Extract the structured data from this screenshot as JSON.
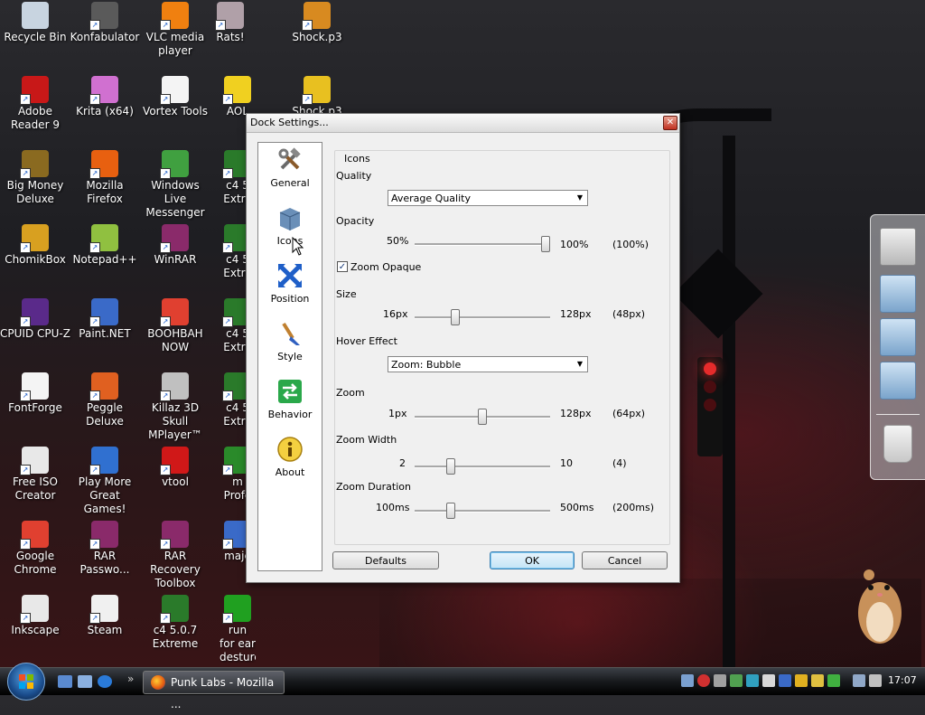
{
  "desktop": {
    "icons": [
      {
        "label": "Recycle Bin",
        "icon": "recycle-bin-icon",
        "color": "#c8d4e0"
      },
      {
        "label": "Konfabulator",
        "icon": "konfabulator-icon",
        "color": "#5a5a5a"
      },
      {
        "label": "VLC media player",
        "icon": "vlc-icon",
        "color": "#f08010"
      },
      {
        "label": "Rats!",
        "icon": "rats-icon",
        "color": "#b0a0a8"
      },
      {
        "label": "Shock.p3",
        "icon": "shock-icon",
        "color": "#d88a20"
      },
      {
        "label": "Adobe Reader 9",
        "icon": "adobe-reader-icon",
        "color": "#c81818"
      },
      {
        "label": "Krita (x64)",
        "icon": "krita-icon",
        "color": "#d070d0"
      },
      {
        "label": "Vortex Tools",
        "icon": "vortex-tools-icon",
        "color": "#f4f4f4"
      },
      {
        "label": "AOL",
        "icon": "aol-icon",
        "color": "#f0d020"
      },
      {
        "label": "Shock.p3",
        "icon": "shock-radiation-icon",
        "color": "#e8c020"
      },
      {
        "label": "Big Money Deluxe",
        "icon": "big-money-icon",
        "color": "#8a6a20"
      },
      {
        "label": "Mozilla Firefox",
        "icon": "firefox-icon",
        "color": "#e86010"
      },
      {
        "label": "Windows Live Messenger",
        "icon": "messenger-icon",
        "color": "#40a040"
      },
      {
        "label": "c4 5 Extre",
        "icon": "c4-icon",
        "color": "#2a7a2a"
      },
      {
        "label": "ChomikBox",
        "icon": "chomikbox-icon",
        "color": "#d8a020"
      },
      {
        "label": "Notepad++",
        "icon": "notepadpp-icon",
        "color": "#90c040"
      },
      {
        "label": "WinRAR",
        "icon": "winrar-icon",
        "color": "#8a2a6a"
      },
      {
        "label": "c4 5 Extre",
        "icon": "c4-icon",
        "color": "#2a7a2a"
      },
      {
        "label": "CPUID CPU-Z",
        "icon": "cpuz-icon",
        "color": "#5a2a8a"
      },
      {
        "label": "Paint.NET",
        "icon": "paintnet-icon",
        "color": "#3a6ac8"
      },
      {
        "label": "BOOHBAH NOW",
        "icon": "chrome-icon",
        "color": "#e04030"
      },
      {
        "label": "c4 5 Extre",
        "icon": "c4-icon",
        "color": "#2a7a2a"
      },
      {
        "label": "FontForge",
        "icon": "fontforge-icon",
        "color": "#f4f4f4"
      },
      {
        "label": "Peggle Deluxe",
        "icon": "peggle-icon",
        "color": "#e06020"
      },
      {
        "label": "Killaz 3D Skull MPlayer™",
        "icon": "mplayer-icon",
        "color": "#c0c0c0"
      },
      {
        "label": "c4 5 Extre",
        "icon": "c4-icon",
        "color": "#2a7a2a"
      },
      {
        "label": "Free ISO Creator",
        "icon": "iso-creator-icon",
        "color": "#e8e8e8"
      },
      {
        "label": "Play More Great Games!",
        "icon": "games-icon",
        "color": "#3070d0"
      },
      {
        "label": "vtool",
        "icon": "vtool-icon",
        "color": "#d01818"
      },
      {
        "label": "m Profe",
        "icon": "profe-icon",
        "color": "#2a8a2a"
      },
      {
        "label": "Google Chrome",
        "icon": "chrome-icon",
        "color": "#e04030"
      },
      {
        "label": "RAR Passwo...",
        "icon": "rar-password-icon",
        "color": "#8a2a6a"
      },
      {
        "label": "RAR Recovery Toolbox",
        "icon": "rar-recovery-icon",
        "color": "#8a2a6a"
      },
      {
        "label": "maje",
        "icon": "maje-icon",
        "color": "#3a6ac8"
      },
      {
        "label": "Inkscape",
        "icon": "inkscape-icon",
        "color": "#e8e8e8"
      },
      {
        "label": "Steam",
        "icon": "steam-icon",
        "color": "#f0f0f0"
      },
      {
        "label": "c4 5.0.7 Extreme",
        "icon": "c4-icon",
        "color": "#2a7a2a"
      },
      {
        "label": "run for ear desturction",
        "icon": "run-icon",
        "color": "#20a020"
      }
    ]
  },
  "dialog": {
    "title": "Dock Settings...",
    "sidebar": [
      {
        "label": "General",
        "icon": "tools-icon"
      },
      {
        "label": "Icons",
        "icon": "box-icon",
        "selected": true
      },
      {
        "label": "Position",
        "icon": "arrows-icon"
      },
      {
        "label": "Style",
        "icon": "brush-icon"
      },
      {
        "label": "Behavior",
        "icon": "behavior-icon"
      },
      {
        "label": "About",
        "icon": "info-icon"
      }
    ],
    "section_title": "Icons",
    "quality": {
      "label": "Quality",
      "value": "Average Quality"
    },
    "opacity": {
      "label": "Opacity",
      "min": "50%",
      "max": "100%",
      "current": "(100%)",
      "level": 1.0
    },
    "zoom_opaque": {
      "label": "Zoom Opaque",
      "checked": true
    },
    "size": {
      "label": "Size",
      "min": "16px",
      "max": "128px",
      "current": "(48px)",
      "level": 0.286
    },
    "hover_effect": {
      "label": "Hover Effect",
      "value": "Zoom: Bubble"
    },
    "zoom": {
      "label": "Zoom",
      "min": "1px",
      "max": "128px",
      "current": "(64px)",
      "level": 0.5
    },
    "zoom_width": {
      "label": "Zoom Width",
      "min": "2",
      "max": "10",
      "current": "(4)",
      "level": 0.25
    },
    "zoom_duration": {
      "label": "Zoom Duration",
      "min": "100ms",
      "max": "500ms",
      "current": "(200ms)",
      "level": 0.25
    },
    "buttons": {
      "defaults": "Defaults",
      "ok": "OK",
      "cancel": "Cancel"
    },
    "close_glyph": "✕"
  },
  "taskbar": {
    "task_label": "Punk Labs - Mozilla ...",
    "clock": "17:07"
  }
}
